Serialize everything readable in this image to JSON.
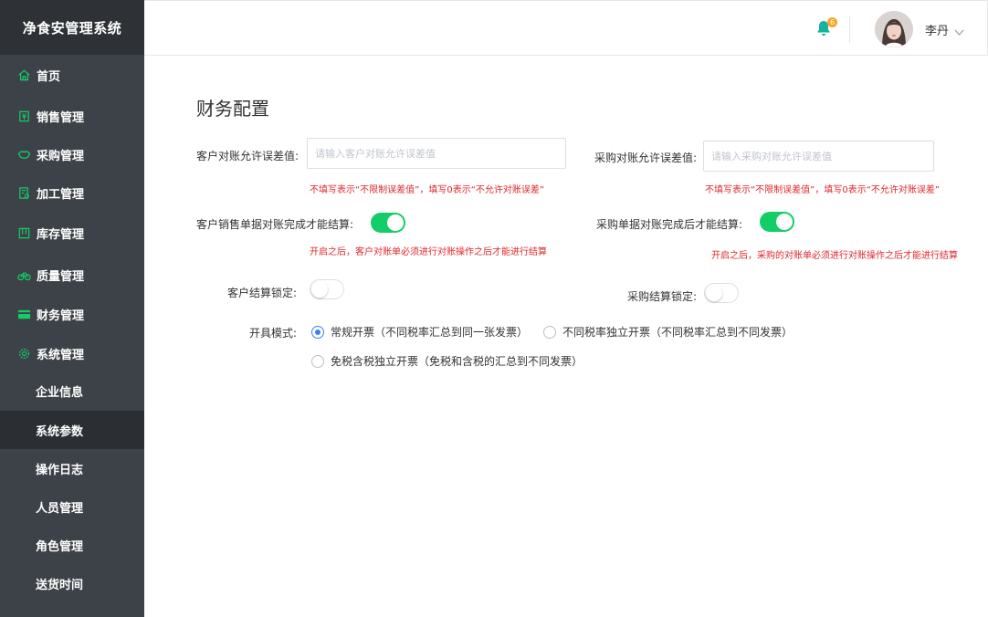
{
  "sidebar": {
    "brand": "净食安管理系统",
    "items": [
      {
        "label": "首页",
        "icon": "home-icon"
      },
      {
        "label": "销售管理",
        "icon": "sales-icon"
      },
      {
        "label": "采购管理",
        "icon": "purchase-icon"
      },
      {
        "label": "加工管理",
        "icon": "processing-icon"
      },
      {
        "label": "库存管理",
        "icon": "inventory-icon"
      },
      {
        "label": "质量管理",
        "icon": "quality-icon"
      },
      {
        "label": "财务管理",
        "icon": "finance-icon"
      },
      {
        "label": "系统管理",
        "icon": "gear-icon"
      }
    ],
    "sub_items": [
      {
        "label": "企业信息"
      },
      {
        "label": "系统参数",
        "active": true
      },
      {
        "label": "操作日志"
      },
      {
        "label": "人员管理"
      },
      {
        "label": "角色管理"
      },
      {
        "label": "送货时间"
      }
    ]
  },
  "header": {
    "notification_count": "6",
    "user_name": "李丹",
    "colors": {
      "bell": "#13b3a0",
      "badge": "#f5a623"
    }
  },
  "main": {
    "title": "财务配置",
    "customer_tolerance": {
      "label": "客户对账允许误差值:",
      "placeholder": "请输入客户对账允许误差值",
      "hint": "不填写表示“不限制误差值”，填写0表示“不允许对账误差”"
    },
    "purchase_tolerance": {
      "label": "采购对账允许误差值:",
      "placeholder": "请输入采购对账允许误差值",
      "hint": "不填写表示“不限制误差值”，填写0表示“不允许对账误差”"
    },
    "customer_settle_after_reconcile": {
      "label": "客户销售单据对账完成才能结算:",
      "on": true,
      "hint": "开启之后，客户对账单必须进行对账操作之后才能进行结算"
    },
    "purchase_settle_after_reconcile": {
      "label": "采购单据对账完成后才能结算:",
      "on": true,
      "hint": "开启之后，采购的对账单必须进行对账操作之后才能进行结算"
    },
    "customer_settle_lock": {
      "label": "客户结算锁定:",
      "on": false
    },
    "purchase_settle_lock": {
      "label": "采购结算锁定:",
      "on": false
    },
    "invoice_mode": {
      "label": "开具模式:",
      "options": [
        {
          "label": "常规开票（不同税率汇总到同一张发票）",
          "checked": true
        },
        {
          "label": "不同税率独立开票（不同税率汇总到不同发票）",
          "checked": false
        },
        {
          "label": "免税含税独立开票（免税和含税的汇总到不同发票）",
          "checked": false
        }
      ]
    }
  },
  "colors": {
    "sidebar_bg": "#3d4248",
    "brand_bg": "#2e3237",
    "active_bg": "#2b2f34",
    "accent_green": "#13ce66",
    "hint_red": "#e0282d",
    "radio_blue": "#3a7ff5"
  }
}
